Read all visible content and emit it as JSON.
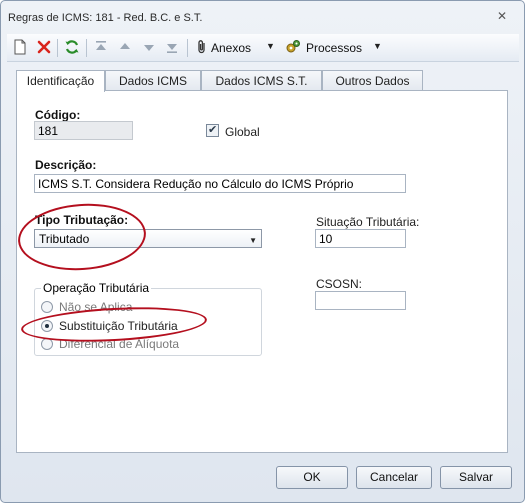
{
  "window": {
    "title": "Regras de ICMS: 181 - Red. B.C. e S.T.",
    "close_symbol": "✕"
  },
  "toolbar": {
    "attachments_label": "Anexos",
    "processes_label": "Processos"
  },
  "tabs": [
    {
      "label": "Identificação",
      "active": true
    },
    {
      "label": "Dados ICMS",
      "active": false
    },
    {
      "label": "Dados ICMS S.T.",
      "active": false
    },
    {
      "label": "Outros Dados",
      "active": false
    }
  ],
  "form": {
    "codigo": {
      "label": "Código:",
      "value": "181"
    },
    "global": {
      "label": "Global",
      "checked": true
    },
    "descricao": {
      "label": "Descrição:",
      "value": "ICMS S.T. Considera Redução no Cálculo do ICMS Próprio"
    },
    "tipo_tributacao": {
      "label": "Tipo Tributação:",
      "value": "Tributado"
    },
    "situacao_tributaria": {
      "label": "Situação Tributária:",
      "value": "10"
    },
    "csosn": {
      "label": "CSOSN:",
      "value": ""
    },
    "operacao": {
      "title": "Operação Tributária",
      "options": [
        {
          "label": "Não se Aplica",
          "checked": false
        },
        {
          "label": "Substituição Tributária",
          "checked": true
        },
        {
          "label": "Diferencial de Alíquota",
          "checked": false
        }
      ]
    }
  },
  "buttons": {
    "ok": "OK",
    "cancel": "Cancelar",
    "save": "Salvar"
  },
  "colors": {
    "annotation": "#b40f1e",
    "delete_icon": "#d9241c",
    "refresh_icon": "#2a8c2a"
  },
  "icons": [
    "new-document-icon",
    "delete-icon",
    "refresh-icon",
    "move-first-icon",
    "move-up-icon",
    "move-down-icon",
    "move-last-icon",
    "paperclip-icon",
    "gears-icon"
  ]
}
